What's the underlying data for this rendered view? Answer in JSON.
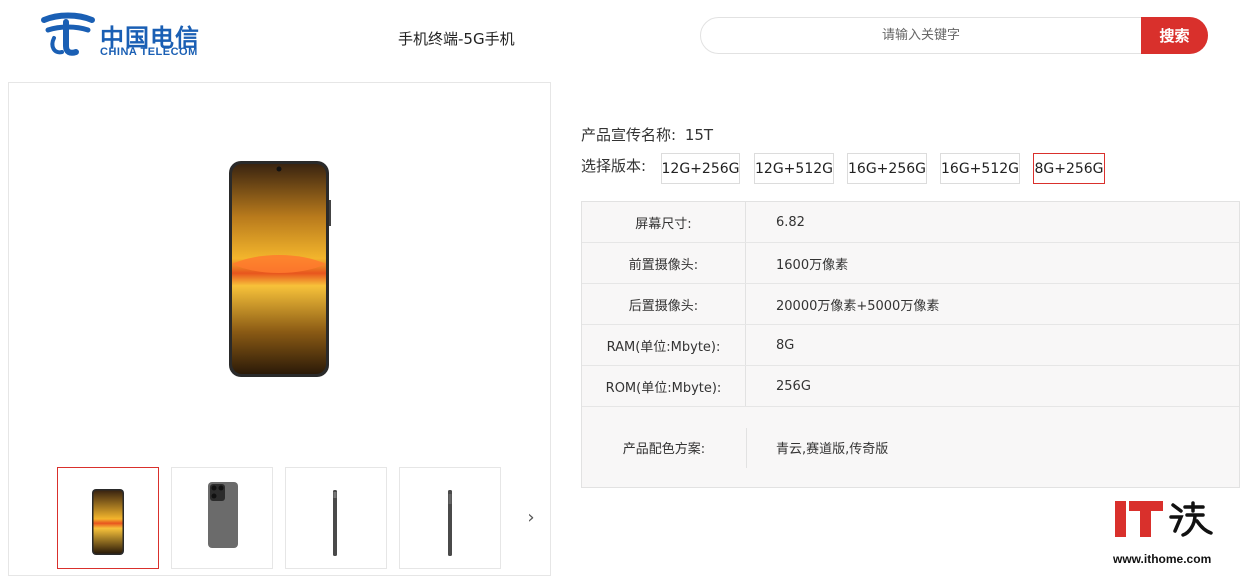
{
  "header": {
    "logo_cn": "中国电信",
    "logo_en": "CHINA TELECOM",
    "page_title": "手机终端-5G手机",
    "search_placeholder": "请输入关键字",
    "search_button": "搜索",
    "brand_color": "#1a5fb4",
    "accent_color": "#d9302c"
  },
  "product": {
    "promo_label": "产品宣传名称:",
    "promo_name": "15T",
    "version_label": "选择版本:",
    "versions": [
      {
        "label": "12G+256G",
        "selected": false
      },
      {
        "label": "12G+512G",
        "selected": false
      },
      {
        "label": "16G+256G",
        "selected": false
      },
      {
        "label": "16G+512G",
        "selected": false
      },
      {
        "label": "8G+256G",
        "selected": true
      }
    ]
  },
  "gallery": {
    "thumbnails": [
      "phone-front",
      "phone-back",
      "phone-side",
      "phone-side"
    ],
    "selected_index": 0,
    "next_icon": "chevron-right-icon"
  },
  "specs": [
    {
      "key": "屏幕尺寸:",
      "value": "6.82"
    },
    {
      "key": "前置摄像头:",
      "value": "1600万像素"
    },
    {
      "key": "后置摄像头:",
      "value": "20000万像素+5000万像素"
    },
    {
      "key": "RAM(单位:Mbyte):",
      "value": "8G"
    },
    {
      "key": "ROM(单位:Mbyte):",
      "value": "256G"
    },
    {
      "key": "产品配色方案:",
      "value": "青云,赛道版,传奇版"
    }
  ],
  "watermark": {
    "url": "www.ithome.com"
  }
}
